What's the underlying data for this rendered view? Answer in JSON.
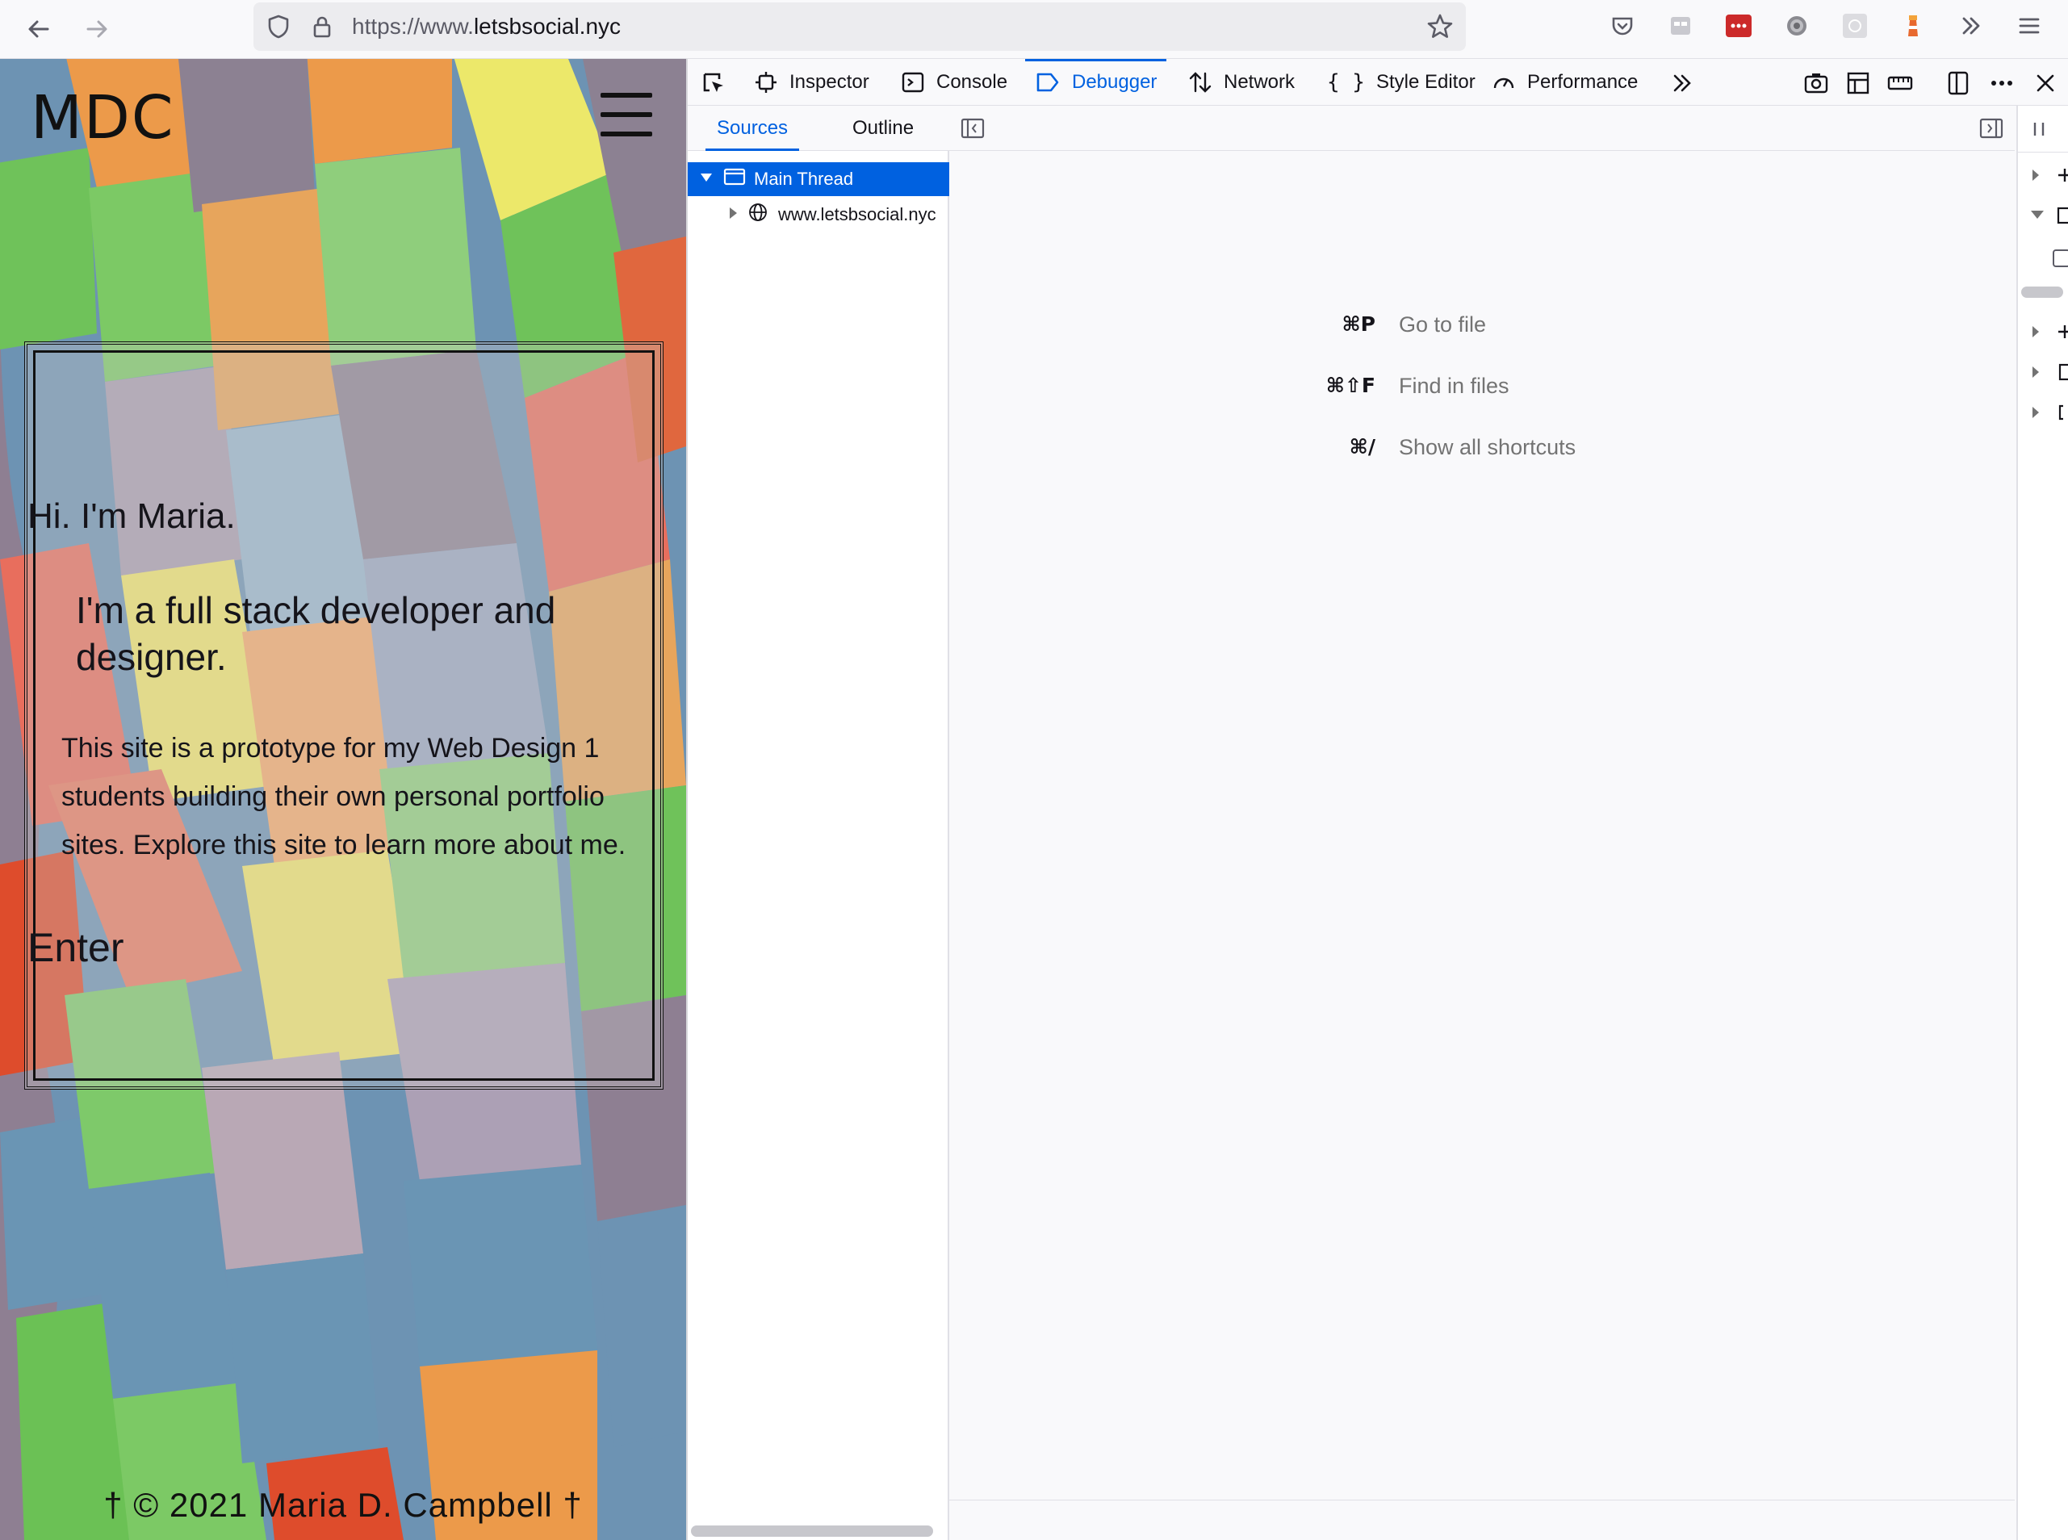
{
  "browser": {
    "url_prefix": "https://www.",
    "url_domain": "letsbsocial.nyc",
    "nav_icons": [
      "back-icon",
      "forward-icon",
      "shield-icon",
      "lock-icon",
      "star-icon"
    ],
    "extension_icons": [
      "pocket-icon",
      "reader-icon",
      "lastpass-icon",
      "settings-gear-icon",
      "extension-icon",
      "lighthouse-icon",
      "overflow-chevron-icon",
      "app-menu-icon"
    ]
  },
  "page": {
    "logo": "MDC",
    "greeting": "Hi. I'm Maria.",
    "role": "I'm a full stack developer and designer.",
    "description": "This site is a prototype for my Web Design 1 students building their own personal portfolio sites. Explore this site to learn more about me.",
    "enter_label": "Enter",
    "footer": "† © 2021 Maria D. Campbell †"
  },
  "devtools": {
    "tabs": [
      {
        "label": "Inspector"
      },
      {
        "label": "Console"
      },
      {
        "label": "Debugger"
      },
      {
        "label": "Network"
      },
      {
        "label": "Style Editor"
      },
      {
        "label": "Performance"
      }
    ],
    "active_tab": "Debugger",
    "sources_tabs": [
      "Sources",
      "Outline"
    ],
    "tree": {
      "thread": "Main Thread",
      "domain": "www.letsbsocial.nyc"
    },
    "shortcuts": [
      {
        "keys": "⌘P",
        "label": "Go to file"
      },
      {
        "keys": "⌘⇧F",
        "label": "Find in files"
      },
      {
        "keys": "⌘/",
        "label": "Show all shortcuts"
      }
    ]
  },
  "colors": {
    "accent": "#0061e0",
    "toolbar_bg": "#f9f9fb",
    "url_bar_bg": "#ececef"
  }
}
